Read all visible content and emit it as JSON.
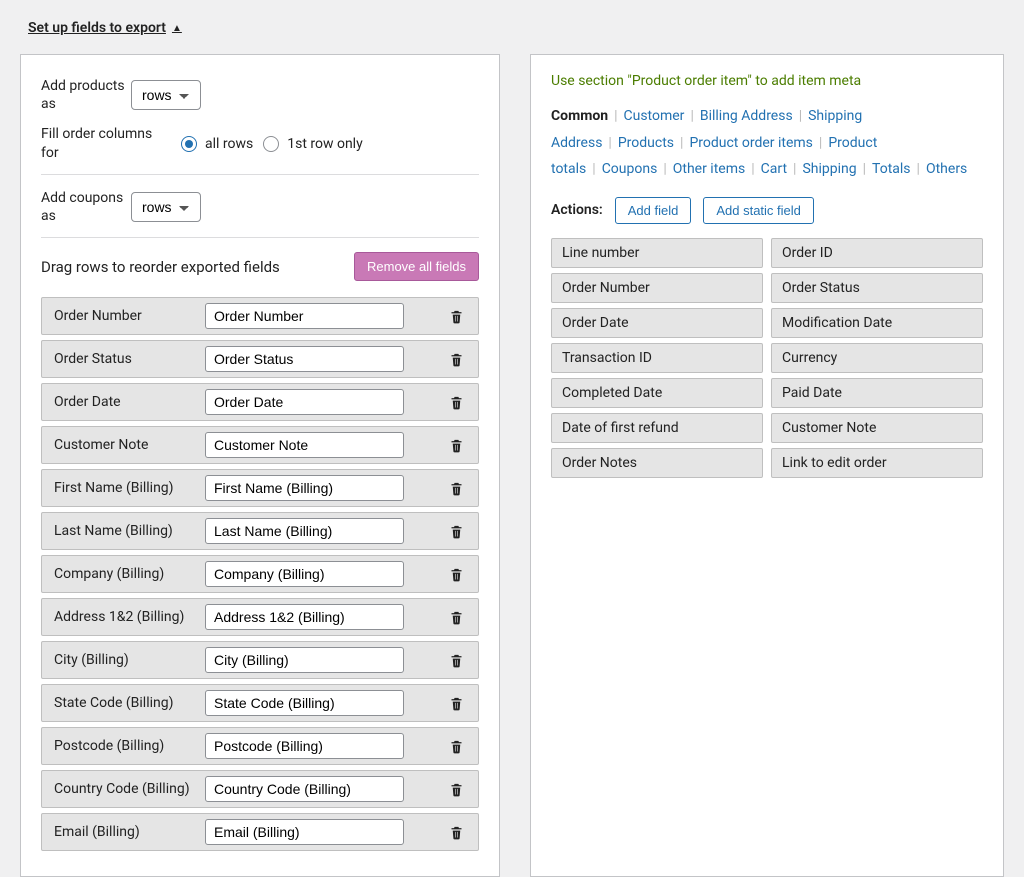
{
  "section_title": "Set up fields to export",
  "left": {
    "add_products_label": "Add products as",
    "add_products_value": "rows",
    "fill_label": "Fill order columns for",
    "fill_options": {
      "all": "all rows",
      "first": "1st row only"
    },
    "fill_selected": "all",
    "add_coupons_label": "Add coupons as",
    "add_coupons_value": "rows",
    "reorder_title": "Drag rows to reorder exported fields",
    "remove_all_label": "Remove all fields",
    "fields": [
      {
        "label": "Order Number",
        "value": "Order Number"
      },
      {
        "label": "Order Status",
        "value": "Order Status"
      },
      {
        "label": "Order Date",
        "value": "Order Date"
      },
      {
        "label": "Customer Note",
        "value": "Customer Note"
      },
      {
        "label": "First Name (Billing)",
        "value": "First Name (Billing)"
      },
      {
        "label": "Last Name (Billing)",
        "value": "Last Name (Billing)"
      },
      {
        "label": "Company (Billing)",
        "value": "Company (Billing)"
      },
      {
        "label": "Address 1&2 (Billing)",
        "value": "Address 1&2 (Billing)"
      },
      {
        "label": "City (Billing)",
        "value": "City (Billing)"
      },
      {
        "label": "State Code (Billing)",
        "value": "State Code (Billing)"
      },
      {
        "label": "Postcode (Billing)",
        "value": "Postcode (Billing)"
      },
      {
        "label": "Country Code (Billing)",
        "value": "Country Code (Billing)"
      },
      {
        "label": "Email (Billing)",
        "value": "Email (Billing)"
      }
    ]
  },
  "right": {
    "hint": "Use section \"Product order item\" to add item meta",
    "tabs": [
      "Common",
      "Customer",
      "Billing Address",
      "Shipping Address",
      "Products",
      "Product order items",
      "Product totals",
      "Coupons",
      "Other items",
      "Cart",
      "Shipping",
      "Totals",
      "Others"
    ],
    "active_tab": "Common",
    "actions_label": "Actions:",
    "add_field_label": "Add field",
    "add_static_label": "Add static field",
    "available": [
      "Line number",
      "Order ID",
      "Order Number",
      "Order Status",
      "Order Date",
      "Modification Date",
      "Transaction ID",
      "Currency",
      "Completed Date",
      "Paid Date",
      "Date of first refund",
      "Customer Note",
      "Order Notes",
      "Link to edit order"
    ]
  }
}
